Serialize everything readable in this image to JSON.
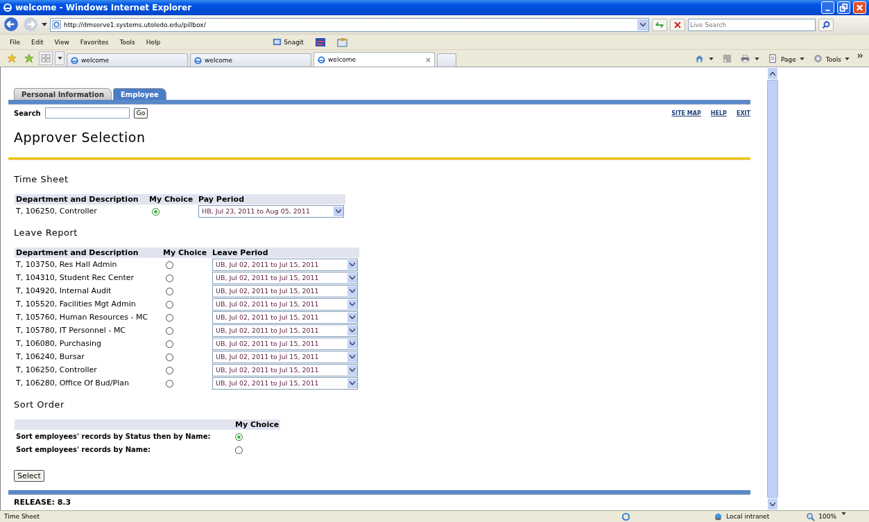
{
  "window": {
    "title": "welcome - Windows Internet Explorer"
  },
  "address_bar": {
    "url": "http://dmserve1.systems.utoledo.edu/pillbox/"
  },
  "live_search": {
    "placeholder": "Live Search"
  },
  "menu": [
    "File",
    "Edit",
    "View",
    "Favorites",
    "Tools",
    "Help"
  ],
  "snagit_label": "Snagit",
  "browser_tabs": [
    {
      "label": "welcome",
      "selected": false
    },
    {
      "label": "welcome",
      "selected": false
    },
    {
      "label": "welcome",
      "selected": true
    }
  ],
  "command_bar": [
    "Page",
    "Tools"
  ],
  "page_tabs": [
    {
      "label": "Personal Information",
      "selected": false
    },
    {
      "label": "Employee",
      "selected": true
    }
  ],
  "search": {
    "label": "Search",
    "button": "Go"
  },
  "links": [
    "SITE MAP",
    "HELP",
    "EXIT"
  ],
  "heading": "Approver Selection",
  "time_sheet": {
    "title": "Time Sheet",
    "columns": [
      "Department and Description",
      "My Choice",
      "Pay Period"
    ],
    "rows": [
      {
        "department": "T, 106250, Controller",
        "selected": true,
        "period": "HB, Jul 23, 2011 to Aug 05, 2011"
      }
    ]
  },
  "leave_report": {
    "title": "Leave Report",
    "columns": [
      "Department and Description",
      "My Choice",
      "Leave Period"
    ],
    "rows": [
      {
        "department": "T, 103750, Res Hall Admin",
        "selected": false,
        "period": "UB, Jul 02, 2011 to Jul 15, 2011"
      },
      {
        "department": "T, 104310, Student Rec Center",
        "selected": false,
        "period": "UB, Jul 02, 2011 to Jul 15, 2011"
      },
      {
        "department": "T, 104920, Internal Audit",
        "selected": false,
        "period": "UB, Jul 02, 2011 to Jul 15, 2011"
      },
      {
        "department": "T, 105520, Facilities Mgt Admin",
        "selected": false,
        "period": "UB, Jul 02, 2011 to Jul 15, 2011"
      },
      {
        "department": "T, 105760, Human Resources - MC",
        "selected": false,
        "period": "UB, Jul 02, 2011 to Jul 15, 2011"
      },
      {
        "department": "T, 105780, IT Personnel - MC",
        "selected": false,
        "period": "UB, Jul 02, 2011 to Jul 15, 2011"
      },
      {
        "department": "T, 106080, Purchasing",
        "selected": false,
        "period": "UB, Jul 02, 2011 to Jul 15, 2011"
      },
      {
        "department": "T, 106240, Bursar",
        "selected": false,
        "period": "UB, Jul 02, 2011 to Jul 15, 2011"
      },
      {
        "department": "T, 106250, Controller",
        "selected": false,
        "period": "UB, Jul 02, 2011 to Jul 15, 2011"
      },
      {
        "department": "T, 106280, Office Of Bud/Plan",
        "selected": false,
        "period": "UB, Jul 02, 2011 to Jul 15, 2011"
      }
    ]
  },
  "sort_order": {
    "title": "Sort Order",
    "column": "My Choice",
    "options": [
      {
        "label": "Sort employees' records by Status then by Name:",
        "selected": true
      },
      {
        "label": "Sort employees' records by Name:",
        "selected": false
      }
    ]
  },
  "select_button": "Select",
  "release": "RELEASE: 8.3",
  "status_bar": {
    "text": "Time Sheet",
    "zone": "Local intranet",
    "zoom": "100%"
  }
}
